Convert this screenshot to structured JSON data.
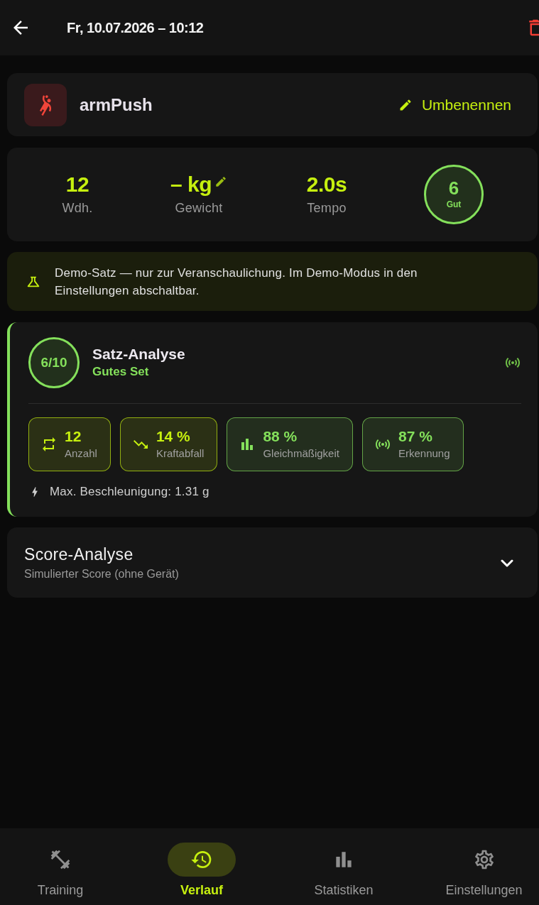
{
  "header": {
    "title": "Fr, 10.07.2026 – 10:12"
  },
  "exercise": {
    "name": "armPush",
    "rename_label": "Umbenennen"
  },
  "summary": {
    "stats": [
      {
        "value": "12",
        "label": "Wdh.",
        "editable": false
      },
      {
        "value": "– kg",
        "label": "Gewicht",
        "editable": true
      },
      {
        "value": "2.0s",
        "label": "Tempo",
        "editable": false
      }
    ],
    "score": {
      "value": "6",
      "label": "Gut"
    }
  },
  "demo_notice": {
    "text": "Demo-Satz — nur zur Veranschaulichung. Im Demo-Modus in den Einstellungen abschaltbar."
  },
  "set_analysis": {
    "score": "6/10",
    "title": "Satz-Analyse",
    "verdict": "Gutes Set",
    "metrics": [
      {
        "kind": "reps",
        "value": "12",
        "label": "Anzahl",
        "color": "#c6f00f"
      },
      {
        "kind": "drop",
        "value": "14 %",
        "label": "Kraftabfall",
        "color": "#c6f00f"
      },
      {
        "kind": "consistency",
        "value": "88 %",
        "label": "Gleichmäßigkeit",
        "color": "#84e05b"
      },
      {
        "kind": "detection",
        "value": "87 %",
        "label": "Erkennung",
        "color": "#84e05b"
      }
    ],
    "max_acceleration": "Max. Beschleunigung: 1.31 g"
  },
  "score_analysis": {
    "title": "Score-Analyse",
    "subtitle": "Simulierter Score (ohne Gerät)",
    "expanded": false
  },
  "nav": [
    {
      "kind": "training",
      "label": "Training",
      "selected": false
    },
    {
      "kind": "history",
      "label": "Verlauf",
      "selected": true
    },
    {
      "kind": "stats",
      "label": "Statistiken",
      "selected": false
    },
    {
      "kind": "settings",
      "label": "Einstellungen",
      "selected": false
    }
  ]
}
